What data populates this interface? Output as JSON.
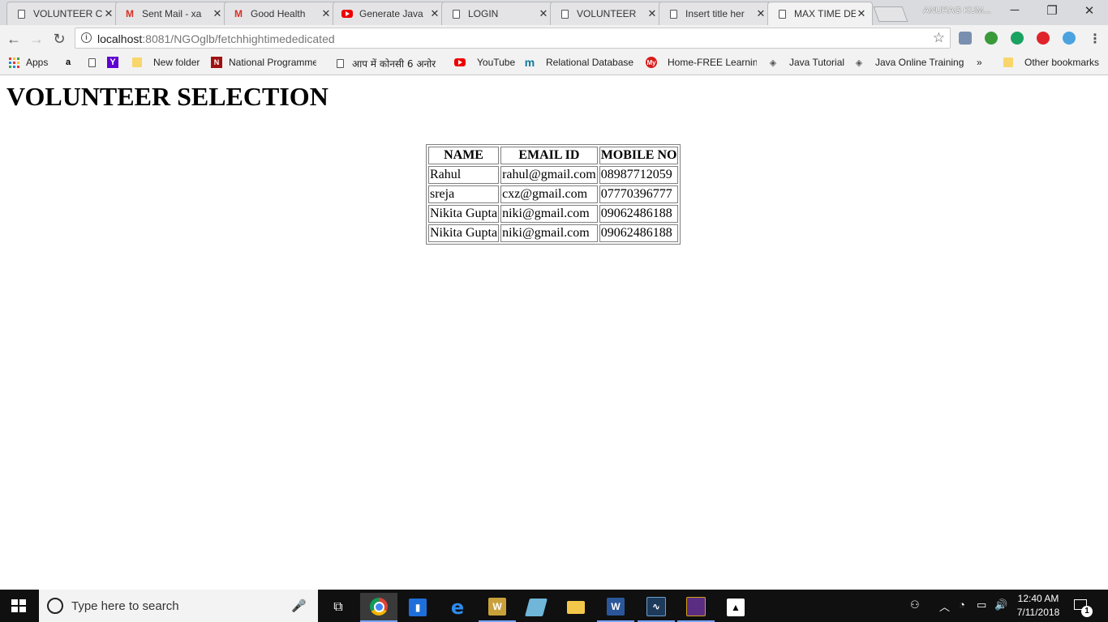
{
  "browser": {
    "tabs": [
      {
        "title": "VOLUNTEER C",
        "icon": "document-icon"
      },
      {
        "title": "Sent Mail - xa",
        "icon": "gmail-icon"
      },
      {
        "title": "Good Health",
        "icon": "gmail-icon"
      },
      {
        "title": "Generate Java",
        "icon": "youtube-icon"
      },
      {
        "title": "LOGIN",
        "icon": "document-icon"
      },
      {
        "title": "VOLUNTEER",
        "icon": "document-icon"
      },
      {
        "title": "Insert title her",
        "icon": "document-icon"
      },
      {
        "title": "MAX TIME DE",
        "icon": "document-icon",
        "active": true
      }
    ],
    "profile_name": "ANURAG KUM...",
    "address": {
      "host": "localhost",
      "path": ":8081/NGOglb/fetchhightimededicated"
    },
    "bookmarks": [
      {
        "label": "Apps",
        "icon": "apps-grid-icon"
      },
      {
        "label": "",
        "icon": "amazon-icon"
      },
      {
        "label": "",
        "icon": "document-icon"
      },
      {
        "label": "",
        "icon": "yahoo-icon"
      },
      {
        "label": "New folder",
        "icon": "folder-icon"
      },
      {
        "label": "National Programme",
        "icon": "nptel-icon"
      },
      {
        "label": "आप में कोनसी 6 अनोर",
        "icon": "document-icon"
      },
      {
        "label": "YouTube",
        "icon": "youtube-icon"
      },
      {
        "label": "Relational Database",
        "icon": "m-icon"
      },
      {
        "label": "Home-FREE Learning",
        "icon": "my-icon"
      },
      {
        "label": "Java Tutorial",
        "icon": "diamond-icon"
      },
      {
        "label": "Java Online Training",
        "icon": "diamond-icon"
      }
    ],
    "overflow": "»",
    "other_bookmarks": "Other bookmarks"
  },
  "page": {
    "heading": "VOLUNTEER SELECTION",
    "table": {
      "headers": [
        "NAME",
        "EMAIL ID",
        "MOBILE NO"
      ],
      "rows": [
        [
          "Rahul",
          "rahul@gmail.com",
          "08987712059"
        ],
        [
          "sreja",
          "cxz@gmail.com",
          "07770396777"
        ],
        [
          "Nikita Gupta",
          "niki@gmail.com",
          "09062486188"
        ],
        [
          "Nikita Gupta",
          "niki@gmail.com",
          "09062486188"
        ]
      ]
    }
  },
  "taskbar": {
    "search_placeholder": "Type here to search",
    "time": "12:40 AM",
    "date": "7/11/2018",
    "notification_count": "1"
  }
}
